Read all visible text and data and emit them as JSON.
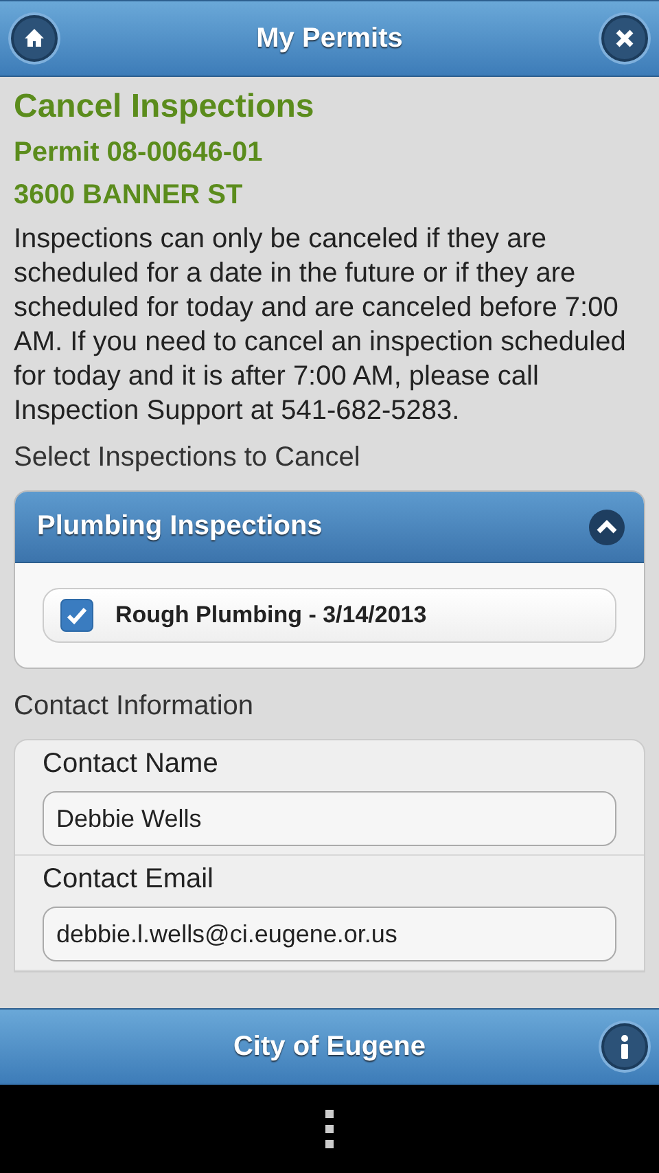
{
  "header": {
    "title": "My Permits"
  },
  "page": {
    "title": "Cancel Inspections",
    "permit": "Permit 08-00646-01",
    "address": "3600 BANNER ST",
    "notice": "Inspections can only be canceled if they are scheduled for a date in the future or if they are scheduled for today and are canceled before 7:00 AM. If you need to cancel an inspection scheduled for today and it is after 7:00 AM, please call Inspection Support at 541-682-5283.",
    "select_label": "Select Inspections to Cancel"
  },
  "inspection_group": {
    "title": "Plumbing Inspections",
    "expanded": true,
    "items": [
      {
        "label": "Rough Plumbing - 3/14/2013",
        "checked": true
      }
    ]
  },
  "contact_label": "Contact Information",
  "contact_fields": [
    {
      "label": "Contact Name",
      "value": "Debbie Wells"
    },
    {
      "label": "Contact Email",
      "value": "debbie.l.wells@ci.eugene.or.us"
    }
  ],
  "footer": {
    "title": "City of Eugene"
  }
}
